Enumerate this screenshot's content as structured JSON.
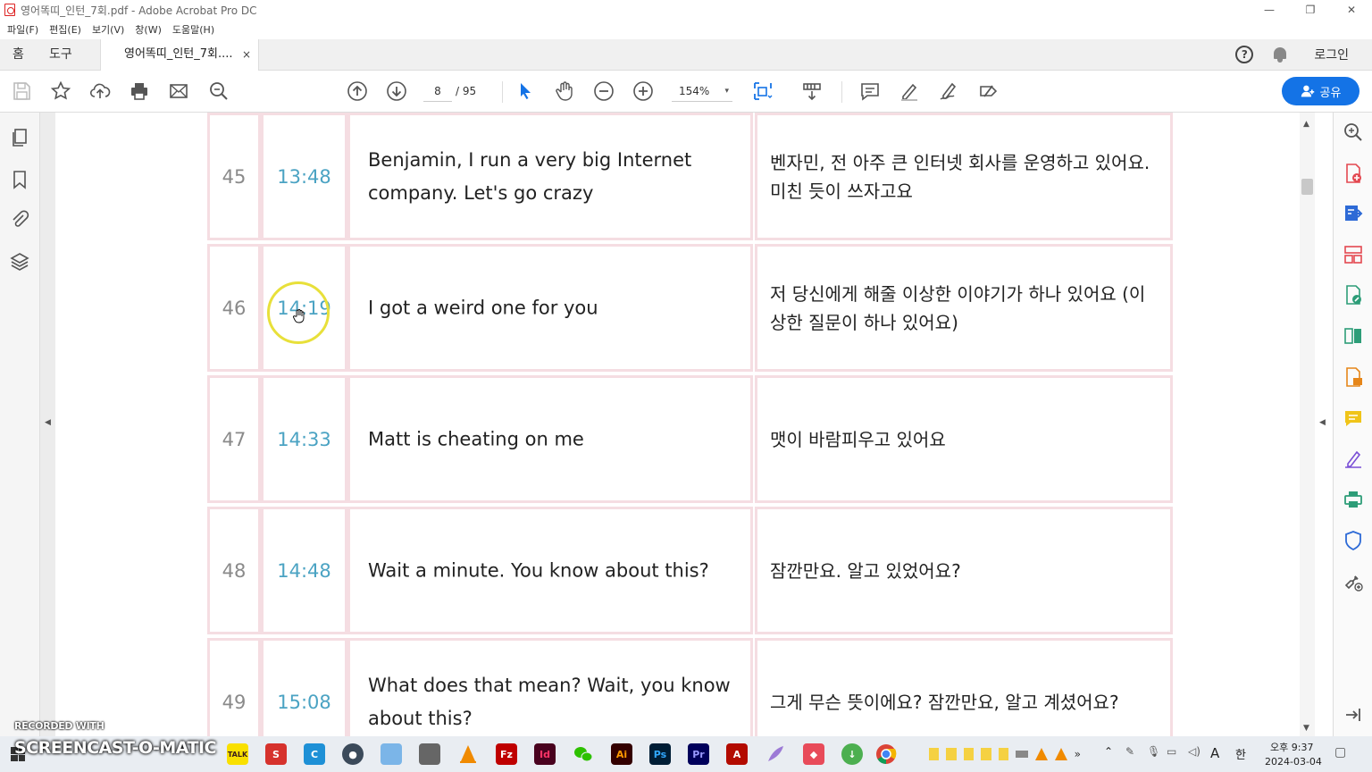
{
  "window": {
    "title": "영어똑띠_인턴_7회.pdf - Adobe Acrobat Pro DC",
    "minimize": "—",
    "restore": "❐",
    "close": "✕"
  },
  "menu": [
    "파일(F)",
    "편집(E)",
    "보기(V)",
    "창(W)",
    "도움말(H)"
  ],
  "tabs": {
    "home": "홈",
    "tools": "도구",
    "document": "영어똑띠_인턴_7회....",
    "document_close": "×",
    "help": "?",
    "login": "로그인"
  },
  "toolbar": {
    "current_page": "8",
    "page_total": "/ 95",
    "zoom": "154%",
    "zoom_caret": "▾",
    "share_label": "공유",
    "accent": "#1473e6"
  },
  "rows": [
    {
      "num": "45",
      "time": "13:48",
      "en": "Benjamin, I run a very big Internet company. Let's go crazy",
      "ko": "벤자민, 전 아주 큰 인터넷 회사를 운영하고 있어요. 미친 듯이 쓰자고요"
    },
    {
      "num": "46",
      "time": "14:19",
      "en": "I got a weird one for you",
      "ko": "저 당신에게 해줄 이상한 이야기가 하나 있어요 (이상한 질문이 하나 있어요)"
    },
    {
      "num": "47",
      "time": "14:33",
      "en": "Matt is cheating on me",
      "ko": "맷이 바람피우고 있어요"
    },
    {
      "num": "48",
      "time": "14:48",
      "en": "Wait a minute. You know about this?",
      "ko": "잠깐만요. 알고 있었어요?"
    },
    {
      "num": "49",
      "time": "15:08",
      "en": "What does that mean? Wait, you know about this?",
      "ko": "그게 무슨 뜻이에요? 잠깐만요, 알고 계셨어요?"
    }
  ],
  "colors": {
    "time_text": "#4ba3c3",
    "cell_border": "#f5dde2",
    "cursor_ring": "#e8e03a"
  },
  "taskbar": {
    "watermark_top": "RECORDED WITH",
    "watermark_brand": "SCREENCAST-O-MATIC",
    "apps": [
      "kakaotalk-icon",
      "stt-icon",
      "c-icon",
      "obs-icon",
      "notes-icon",
      "tool-icon",
      "vlc-icon",
      "filezilla-icon",
      "indesign-icon",
      "wechat-icon",
      "illustrator-icon",
      "photoshop-icon",
      "premiere-icon",
      "acrobat-icon",
      "feather-icon",
      "app-icon",
      "download-icon",
      "chrome-icon"
    ],
    "app_labels": {
      "indesign": "Id",
      "illustrator": "Ai",
      "photoshop": "Ps",
      "premiere": "Pr",
      "kakaotalk": "TALK"
    },
    "clock_time": "오후 9:37",
    "clock_date": "2024-03-04",
    "ime_a": "A",
    "ime_han": "한"
  }
}
